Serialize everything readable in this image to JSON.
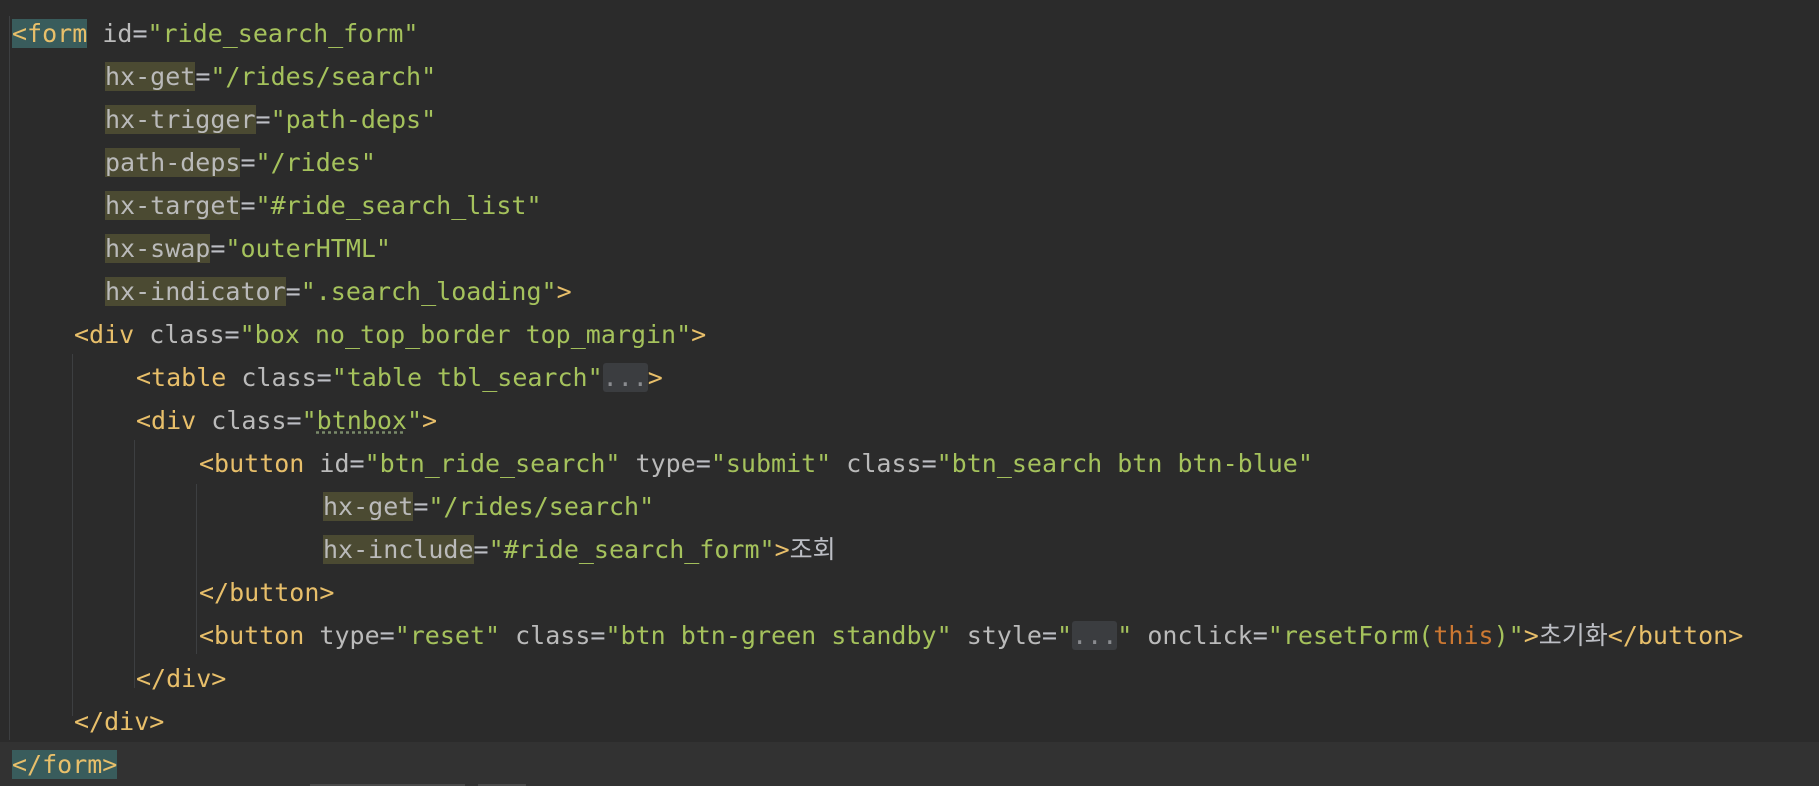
{
  "code": {
    "l1": {
      "tag_open": "<form",
      "attr": "id",
      "value": "\"ride_search_form\""
    },
    "l2": {
      "attr": "hx-get",
      "value": "\"/rides/search\""
    },
    "l3": {
      "attr": "hx-trigger",
      "value": "\"path-deps\""
    },
    "l4": {
      "attr": "path-deps",
      "value": "\"/rides\""
    },
    "l5": {
      "attr": "hx-target",
      "value": "\"#ride_search_list\""
    },
    "l6": {
      "attr": "hx-swap",
      "value": "\"outerHTML\""
    },
    "l7": {
      "attr": "hx-indicator",
      "value": "\".search_loading\"",
      "close": ">"
    },
    "l8": {
      "tag_open": "<div",
      "attr": "class",
      "value": "\"box no_top_border top_margin\"",
      "close": ">"
    },
    "l9": {
      "tag_open": "<table",
      "attr": "class",
      "value": "\"table tbl_search\"",
      "fold": "...",
      "close": ">"
    },
    "l10": {
      "tag_open": "<div",
      "attr": "class",
      "value_q1": "\"",
      "value_inner": "btnbox",
      "value_q2": "\"",
      "close": ">"
    },
    "l11": {
      "tag_open": "<button",
      "attr1": "id",
      "value1": "\"btn_ride_search\"",
      "attr2": "type",
      "value2": "\"submit\"",
      "attr3": "class",
      "value3": "\"btn_search btn btn-blue\""
    },
    "l12": {
      "attr": "hx-get",
      "value": "\"/rides/search\""
    },
    "l13": {
      "attr": "hx-include",
      "value": "\"#ride_search_form\"",
      "close": ">",
      "text": "조회"
    },
    "l14": {
      "tag_close": "</button>"
    },
    "l15": {
      "tag_open": "<button",
      "attr1": "type",
      "value1": "\"reset\"",
      "attr2": "class",
      "value2": "\"btn btn-green standby\"",
      "attr3": "style",
      "value3_q1": "\"",
      "fold": "...",
      "value3_q2": "\"",
      "attr4": "onclick",
      "value4_a": "\"resetForm(",
      "kw": "this",
      "value4_b": ")\"",
      "close": ">",
      "text": "초기화",
      "tag_end": "</button>"
    },
    "l16": {
      "tag_close": "</div>"
    },
    "l17": {
      "tag_close": "</div>"
    },
    "l18": {
      "tag_close": "</form>"
    }
  }
}
